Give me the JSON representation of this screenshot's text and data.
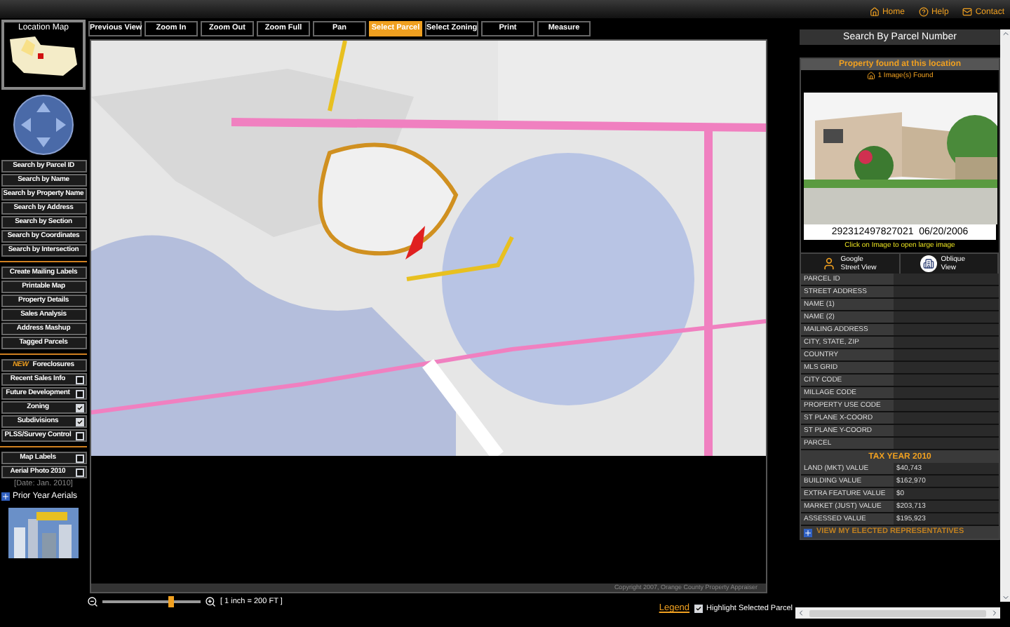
{
  "top_links": [
    {
      "kind": "home",
      "label": "Home"
    },
    {
      "kind": "help",
      "label": "Help"
    },
    {
      "kind": "contact",
      "label": "Contact"
    }
  ],
  "toolbar": [
    {
      "label": "Previous View",
      "selected": false
    },
    {
      "label": "Zoom In",
      "selected": false
    },
    {
      "label": "Zoom Out",
      "selected": false
    },
    {
      "label": "Zoom Full",
      "selected": false
    },
    {
      "label": "Pan",
      "selected": false
    },
    {
      "label": "Select Parcel",
      "selected": true
    },
    {
      "label": "Select Zoning",
      "selected": false
    },
    {
      "label": "Print",
      "selected": false
    },
    {
      "label": "Measure",
      "selected": false
    }
  ],
  "sidebar": {
    "location_map_title": "Location Map",
    "items": [
      {
        "kind": "button",
        "label": "Search by Parcel ID"
      },
      {
        "kind": "button",
        "label": "Search by Name"
      },
      {
        "kind": "button",
        "label": "Search by Property Name"
      },
      {
        "kind": "button",
        "label": "Search by Address"
      },
      {
        "kind": "button",
        "label": "Search by Section"
      },
      {
        "kind": "button",
        "label": "Search by Coordinates"
      },
      {
        "kind": "button",
        "label": "Search by Intersection"
      },
      {
        "kind": "divider"
      },
      {
        "kind": "button",
        "label": "Create Mailing Labels"
      },
      {
        "kind": "button",
        "label": "Printable Map"
      },
      {
        "kind": "button",
        "label": "Property Details"
      },
      {
        "kind": "button",
        "label": "Sales Analysis"
      },
      {
        "kind": "button",
        "label": "Address Mashup"
      },
      {
        "kind": "button",
        "label": "Tagged Parcels"
      },
      {
        "kind": "divider"
      },
      {
        "kind": "new",
        "badge": "NEW",
        "label": "Foreclosures"
      },
      {
        "kind": "toggle",
        "label": "Recent Sales Info",
        "checked": false
      },
      {
        "kind": "toggle",
        "label": "Future Development",
        "checked": false
      },
      {
        "kind": "toggle",
        "label": "Zoning",
        "checked": true
      },
      {
        "kind": "toggle",
        "label": "Subdivisions",
        "checked": true
      },
      {
        "kind": "toggle",
        "label": "PLSS/Survey Control",
        "checked": false
      },
      {
        "kind": "divider"
      },
      {
        "kind": "toggle",
        "label": "Map Labels",
        "checked": false
      },
      {
        "kind": "toggle",
        "label": "Aerial Photo 2010",
        "checked": false
      },
      {
        "kind": "note",
        "label": "[Date: Jan. 2010]"
      },
      {
        "kind": "expand",
        "label": "Prior Year Aerials"
      }
    ]
  },
  "map": {
    "copyright": "Copyright 2007, Orange County Property Appraiser"
  },
  "scale": {
    "level": 0.7,
    "text": "[ 1 inch = 200 FT ]"
  },
  "legend": {
    "link": "Legend",
    "highlight": {
      "label": "Highlight Selected Parcel",
      "checked": true
    }
  },
  "panel": {
    "title": "Search By Parcel Number",
    "found": "Property found at this location",
    "images": "1 Image(s) Found",
    "photo_caption": "292312497827021  06/20/2006",
    "photo_hint": "Click on Image to open large image",
    "views": [
      {
        "kind": "street",
        "label": "Google Street View"
      },
      {
        "kind": "oblique",
        "label": "Oblique View"
      }
    ],
    "fields": [
      {
        "label": "PARCEL ID"
      },
      {
        "label": "STREET ADDRESS"
      },
      {
        "label": "NAME (1)"
      },
      {
        "label": "NAME (2)"
      },
      {
        "label": "MAILING ADDRESS"
      },
      {
        "label": "CITY, STATE, ZIP"
      },
      {
        "label": "COUNTRY"
      },
      {
        "label": "MLS GRID"
      },
      {
        "label": "CITY CODE"
      },
      {
        "label": "MILLAGE CODE"
      },
      {
        "label": "PROPERTY USE CODE"
      },
      {
        "label": "ST PLANE X-COORD"
      },
      {
        "label": "ST PLANE Y-COORD"
      },
      {
        "label": "PARCEL"
      }
    ],
    "tax_year": "TAX YEAR 2010",
    "values": [
      {
        "label": "LAND (MKT) VALUE",
        "value": "$40,743"
      },
      {
        "label": "BUILDING VALUE",
        "value": "$162,970"
      },
      {
        "label": "EXTRA FEATURE VALUE",
        "value": "$0"
      },
      {
        "label": "MARKET (JUST) VALUE",
        "value": "$203,713"
      },
      {
        "label": "ASSESSED VALUE",
        "value": "$195,923"
      }
    ],
    "representatives": "VIEW MY ELECTED REPRESENTATIVES"
  }
}
